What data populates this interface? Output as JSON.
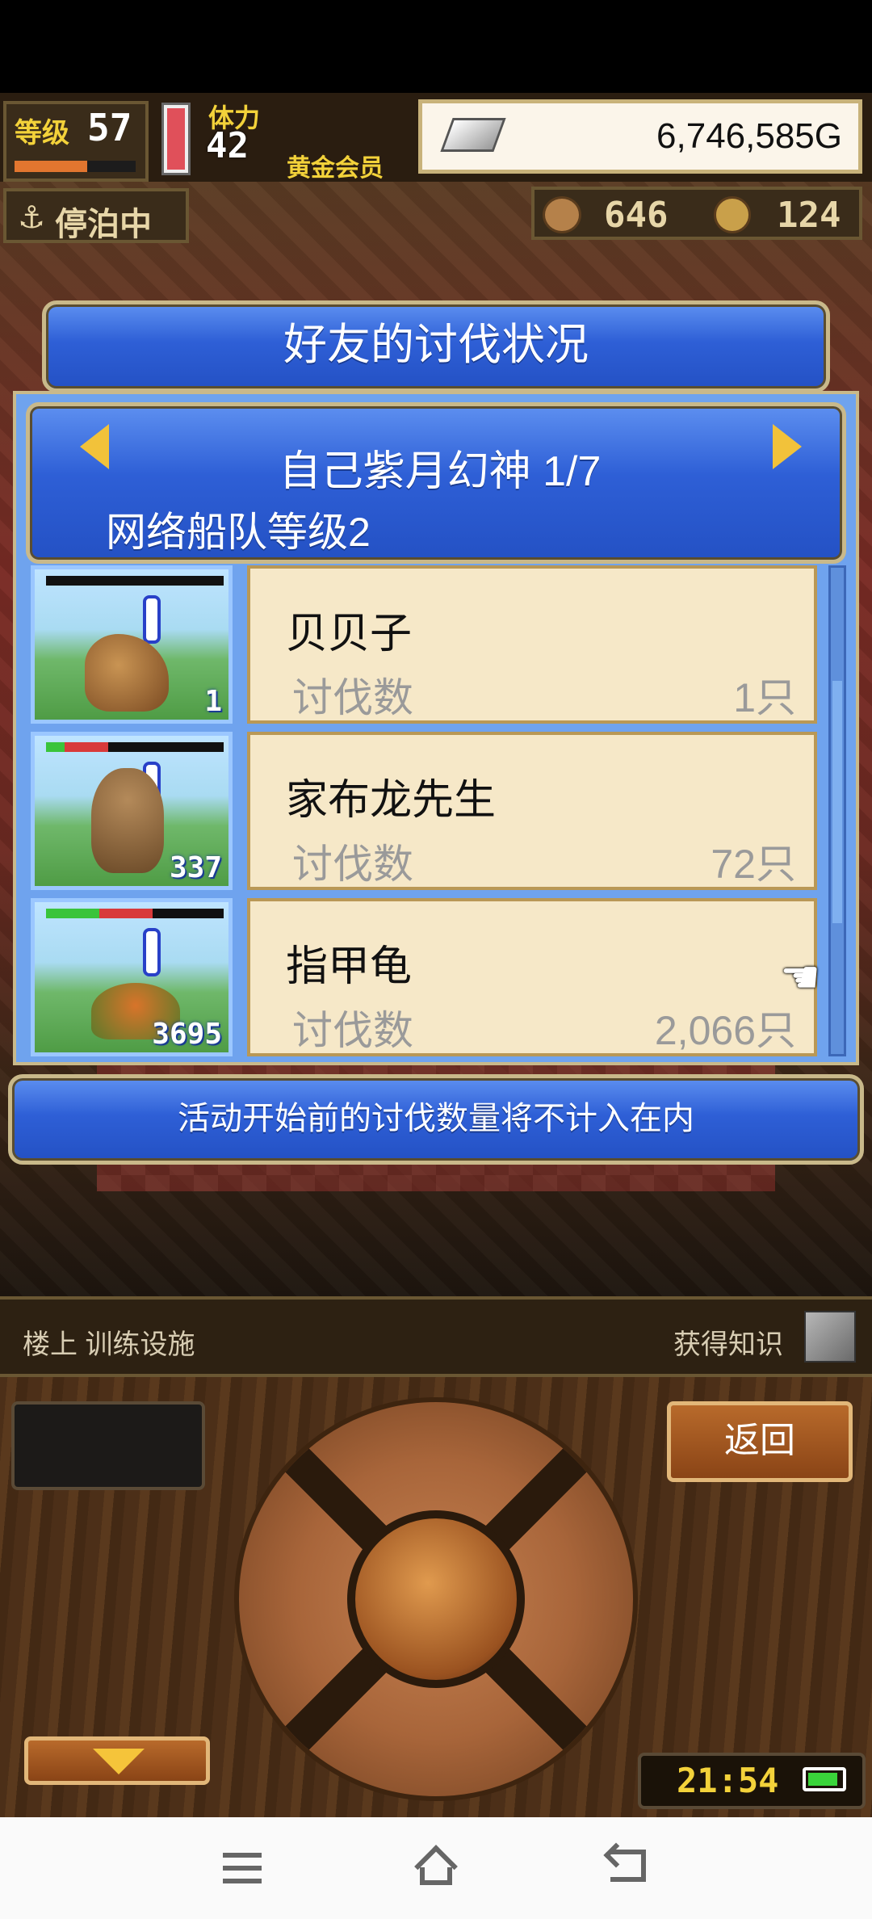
{
  "hud": {
    "level_label": "等级",
    "level_value": "57",
    "stamina_label": "体力",
    "stamina_value": "42",
    "membership": "黄金会员",
    "gold": "6,746,585G",
    "status": "停泊中",
    "resource_a": "646",
    "resource_b": "124"
  },
  "dialog": {
    "title": "好友的讨伐状况",
    "subtitle": "自己紫月幻神 1/7",
    "fleet_level": "网络船队等级2",
    "rows": [
      {
        "name": "贝贝子",
        "stat_label": "讨伐数",
        "stat_value": "1只",
        "badge": "1"
      },
      {
        "name": "家布龙先生",
        "stat_label": "讨伐数",
        "stat_value": "72只",
        "badge": "337"
      },
      {
        "name": "指甲龟",
        "stat_label": "讨伐数",
        "stat_value": "2,066只",
        "badge": "3695"
      }
    ],
    "footer_note": "活动开始前的讨伐数量将不计入在内"
  },
  "location": {
    "left": "楼上 训练设施",
    "right": "获得知识"
  },
  "controls": {
    "back_label": "返回",
    "clock": "21:54"
  },
  "icons": {
    "prev": "triangle-left-icon",
    "next": "triangle-right-icon",
    "pointer": "hand-pointer-icon",
    "menu": "menu-icon",
    "home": "home-icon",
    "back": "back-icon"
  }
}
